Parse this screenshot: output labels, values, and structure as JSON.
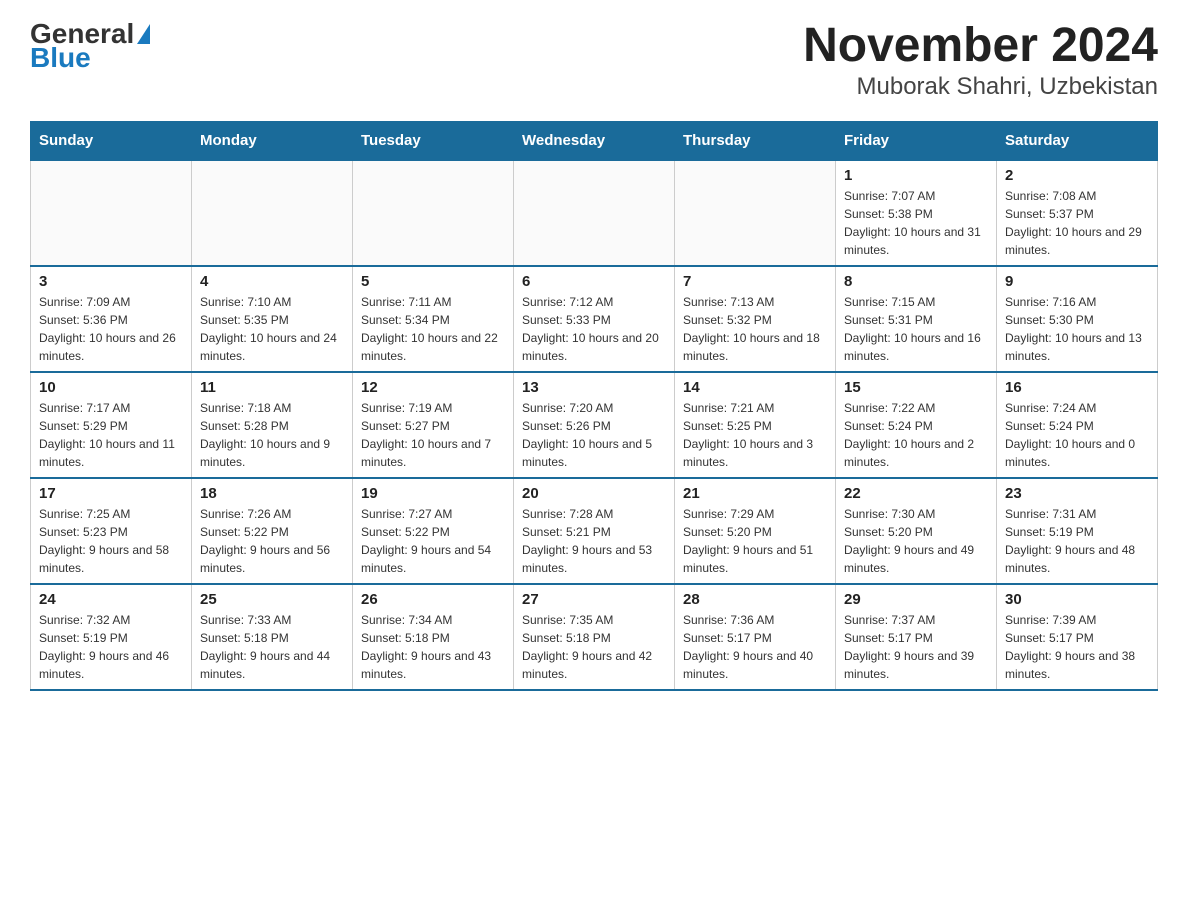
{
  "logo": {
    "general": "General",
    "blue": "Blue"
  },
  "title": "November 2024",
  "subtitle": "Muborak Shahri, Uzbekistan",
  "weekdays": [
    "Sunday",
    "Monday",
    "Tuesday",
    "Wednesday",
    "Thursday",
    "Friday",
    "Saturday"
  ],
  "weeks": [
    [
      {
        "day": "",
        "info": ""
      },
      {
        "day": "",
        "info": ""
      },
      {
        "day": "",
        "info": ""
      },
      {
        "day": "",
        "info": ""
      },
      {
        "day": "",
        "info": ""
      },
      {
        "day": "1",
        "info": "Sunrise: 7:07 AM\nSunset: 5:38 PM\nDaylight: 10 hours and 31 minutes."
      },
      {
        "day": "2",
        "info": "Sunrise: 7:08 AM\nSunset: 5:37 PM\nDaylight: 10 hours and 29 minutes."
      }
    ],
    [
      {
        "day": "3",
        "info": "Sunrise: 7:09 AM\nSunset: 5:36 PM\nDaylight: 10 hours and 26 minutes."
      },
      {
        "day": "4",
        "info": "Sunrise: 7:10 AM\nSunset: 5:35 PM\nDaylight: 10 hours and 24 minutes."
      },
      {
        "day": "5",
        "info": "Sunrise: 7:11 AM\nSunset: 5:34 PM\nDaylight: 10 hours and 22 minutes."
      },
      {
        "day": "6",
        "info": "Sunrise: 7:12 AM\nSunset: 5:33 PM\nDaylight: 10 hours and 20 minutes."
      },
      {
        "day": "7",
        "info": "Sunrise: 7:13 AM\nSunset: 5:32 PM\nDaylight: 10 hours and 18 minutes."
      },
      {
        "day": "8",
        "info": "Sunrise: 7:15 AM\nSunset: 5:31 PM\nDaylight: 10 hours and 16 minutes."
      },
      {
        "day": "9",
        "info": "Sunrise: 7:16 AM\nSunset: 5:30 PM\nDaylight: 10 hours and 13 minutes."
      }
    ],
    [
      {
        "day": "10",
        "info": "Sunrise: 7:17 AM\nSunset: 5:29 PM\nDaylight: 10 hours and 11 minutes."
      },
      {
        "day": "11",
        "info": "Sunrise: 7:18 AM\nSunset: 5:28 PM\nDaylight: 10 hours and 9 minutes."
      },
      {
        "day": "12",
        "info": "Sunrise: 7:19 AM\nSunset: 5:27 PM\nDaylight: 10 hours and 7 minutes."
      },
      {
        "day": "13",
        "info": "Sunrise: 7:20 AM\nSunset: 5:26 PM\nDaylight: 10 hours and 5 minutes."
      },
      {
        "day": "14",
        "info": "Sunrise: 7:21 AM\nSunset: 5:25 PM\nDaylight: 10 hours and 3 minutes."
      },
      {
        "day": "15",
        "info": "Sunrise: 7:22 AM\nSunset: 5:24 PM\nDaylight: 10 hours and 2 minutes."
      },
      {
        "day": "16",
        "info": "Sunrise: 7:24 AM\nSunset: 5:24 PM\nDaylight: 10 hours and 0 minutes."
      }
    ],
    [
      {
        "day": "17",
        "info": "Sunrise: 7:25 AM\nSunset: 5:23 PM\nDaylight: 9 hours and 58 minutes."
      },
      {
        "day": "18",
        "info": "Sunrise: 7:26 AM\nSunset: 5:22 PM\nDaylight: 9 hours and 56 minutes."
      },
      {
        "day": "19",
        "info": "Sunrise: 7:27 AM\nSunset: 5:22 PM\nDaylight: 9 hours and 54 minutes."
      },
      {
        "day": "20",
        "info": "Sunrise: 7:28 AM\nSunset: 5:21 PM\nDaylight: 9 hours and 53 minutes."
      },
      {
        "day": "21",
        "info": "Sunrise: 7:29 AM\nSunset: 5:20 PM\nDaylight: 9 hours and 51 minutes."
      },
      {
        "day": "22",
        "info": "Sunrise: 7:30 AM\nSunset: 5:20 PM\nDaylight: 9 hours and 49 minutes."
      },
      {
        "day": "23",
        "info": "Sunrise: 7:31 AM\nSunset: 5:19 PM\nDaylight: 9 hours and 48 minutes."
      }
    ],
    [
      {
        "day": "24",
        "info": "Sunrise: 7:32 AM\nSunset: 5:19 PM\nDaylight: 9 hours and 46 minutes."
      },
      {
        "day": "25",
        "info": "Sunrise: 7:33 AM\nSunset: 5:18 PM\nDaylight: 9 hours and 44 minutes."
      },
      {
        "day": "26",
        "info": "Sunrise: 7:34 AM\nSunset: 5:18 PM\nDaylight: 9 hours and 43 minutes."
      },
      {
        "day": "27",
        "info": "Sunrise: 7:35 AM\nSunset: 5:18 PM\nDaylight: 9 hours and 42 minutes."
      },
      {
        "day": "28",
        "info": "Sunrise: 7:36 AM\nSunset: 5:17 PM\nDaylight: 9 hours and 40 minutes."
      },
      {
        "day": "29",
        "info": "Sunrise: 7:37 AM\nSunset: 5:17 PM\nDaylight: 9 hours and 39 minutes."
      },
      {
        "day": "30",
        "info": "Sunrise: 7:39 AM\nSunset: 5:17 PM\nDaylight: 9 hours and 38 minutes."
      }
    ]
  ]
}
